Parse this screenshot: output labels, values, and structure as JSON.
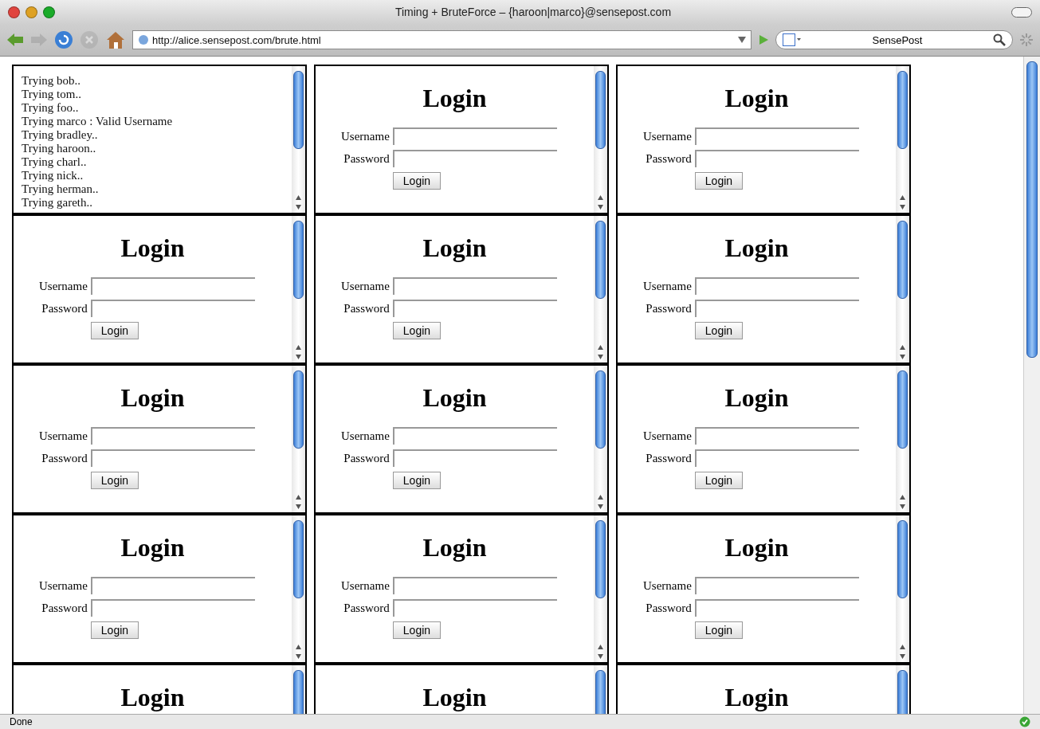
{
  "window": {
    "title": "Timing + BruteForce – {haroon|marco}@sensepost.com"
  },
  "toolbar": {
    "back_enabled": true,
    "forward_enabled": false,
    "stop_enabled": false,
    "url": "http://alice.sensepost.com/brute.html",
    "search": "SensePost"
  },
  "frames": [
    {
      "kind": "log",
      "lines": [
        "Trying bob..",
        "Trying tom..",
        "Trying foo..",
        "Trying marco : Valid Username",
        "Trying bradley..",
        "Trying haroon..",
        "Trying charl..",
        "Trying nick..",
        "Trying herman..",
        "Trying gareth.."
      ]
    },
    {
      "kind": "login",
      "heading": "Login",
      "username_label": "Username",
      "password_label": "Password",
      "button": "Login"
    },
    {
      "kind": "login",
      "heading": "Login",
      "username_label": "Username",
      "password_label": "Password",
      "button": "Login"
    },
    {
      "kind": "login",
      "heading": "Login",
      "username_label": "Username",
      "password_label": "Password",
      "button": "Login"
    },
    {
      "kind": "login",
      "heading": "Login",
      "username_label": "Username",
      "password_label": "Password",
      "button": "Login"
    },
    {
      "kind": "login",
      "heading": "Login",
      "username_label": "Username",
      "password_label": "Password",
      "button": "Login"
    },
    {
      "kind": "login",
      "heading": "Login",
      "username_label": "Username",
      "password_label": "Password",
      "button": "Login"
    },
    {
      "kind": "login",
      "heading": "Login",
      "username_label": "Username",
      "password_label": "Password",
      "button": "Login"
    },
    {
      "kind": "login",
      "heading": "Login",
      "username_label": "Username",
      "password_label": "Password",
      "button": "Login"
    },
    {
      "kind": "login",
      "heading": "Login",
      "username_label": "Username",
      "password_label": "Password",
      "button": "Login"
    },
    {
      "kind": "login",
      "heading": "Login",
      "username_label": "Username",
      "password_label": "Password",
      "button": "Login"
    },
    {
      "kind": "login",
      "heading": "Login",
      "username_label": "Username",
      "password_label": "Password",
      "button": "Login"
    },
    {
      "kind": "login",
      "heading": "Login"
    },
    {
      "kind": "login",
      "heading": "Login"
    },
    {
      "kind": "login",
      "heading": "Login"
    }
  ],
  "status_bar": {
    "text": "Done"
  }
}
